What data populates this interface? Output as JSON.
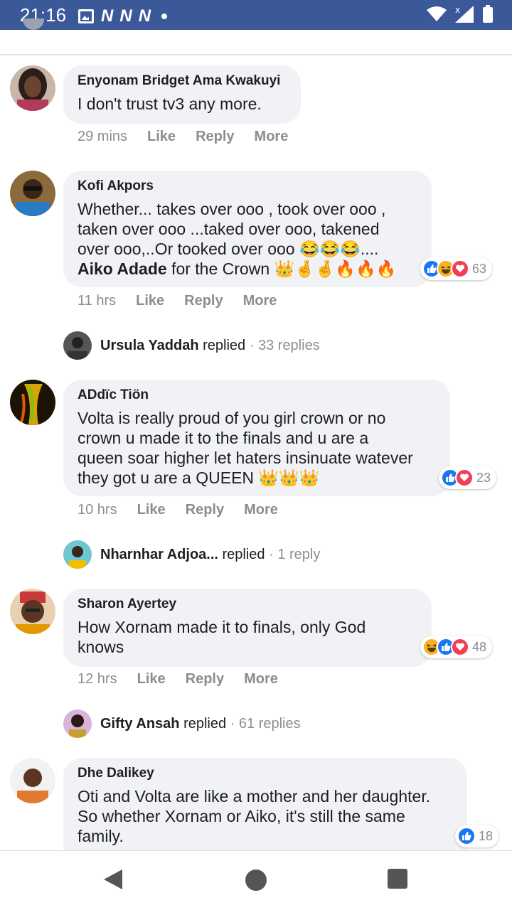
{
  "status_bar": {
    "time": "21:16",
    "notification_icons": [
      "image-icon",
      "n-icon",
      "n-icon",
      "n-icon"
    ],
    "n_glyph": "N",
    "right_icons": [
      "wifi-icon",
      "signal-icon",
      "battery-icon"
    ]
  },
  "comments": [
    {
      "author": "Enyonam Bridget Ama Kwakuyi",
      "text": "I don't trust tv3 any more.",
      "time": "29 mins",
      "like": "Like",
      "reply": "Reply",
      "more": "More"
    },
    {
      "author": "Kofi Akpors",
      "text_lines": [
        "Whether... takes over ooo , took over ooo ,",
        "taken over ooo ...taked over ooo, takened",
        "over ooo,..Or tooked over ooo 😂😂😂....",
        ""
      ],
      "mention": "Aiko Adade",
      "text_tail": " for the Crown 👑🤞🤞🔥🔥🔥",
      "time": "11 hrs",
      "like": "Like",
      "reply": "Reply",
      "more": "More",
      "reaction_count": "63",
      "reply_summary": {
        "name": "Ursula Yaddah",
        "verb": "replied",
        "count": "· 33 replies"
      }
    },
    {
      "author": "ADdïc Tiön",
      "text_lines": [
        "Volta is really proud of you girl crown or no",
        "crown u made it to the finals and u are a",
        "queen soar higher let haters insinuate watever",
        "they got u are a QUEEN 👑👑👑"
      ],
      "time": "10 hrs",
      "like": "Like",
      "reply": "Reply",
      "more": "More",
      "reaction_count": "23",
      "reply_summary": {
        "name": "Nharnhar Adjoa...",
        "verb": "replied",
        "count": "· 1 reply"
      }
    },
    {
      "author": "Sharon Ayertey",
      "text_lines": [
        "How Xornam made it to finals, only God",
        "knows"
      ],
      "time": "12 hrs",
      "like": "Like",
      "reply": "Reply",
      "more": "More",
      "reaction_count": "48",
      "reply_summary": {
        "name": "Gifty Ansah",
        "verb": "replied",
        "count": "· 61 replies"
      }
    },
    {
      "author": "Dhe Dalikey",
      "text_lines": [
        "Oti and Volta are like a mother and her daughter.",
        "So whether Xornam or Aiko, it's still the same",
        "family."
      ],
      "reaction_count": "18"
    }
  ],
  "nav_bar": {
    "icons": [
      "back-icon",
      "home-icon",
      "recents-icon"
    ]
  },
  "colors": {
    "status_bar": "#3b5998",
    "bubble": "#f0f2f5",
    "meta_text": "#8a8d91",
    "like_blue": "#1877f2",
    "love_red": "#f33e58",
    "haha_yellow": "#f7b125"
  }
}
